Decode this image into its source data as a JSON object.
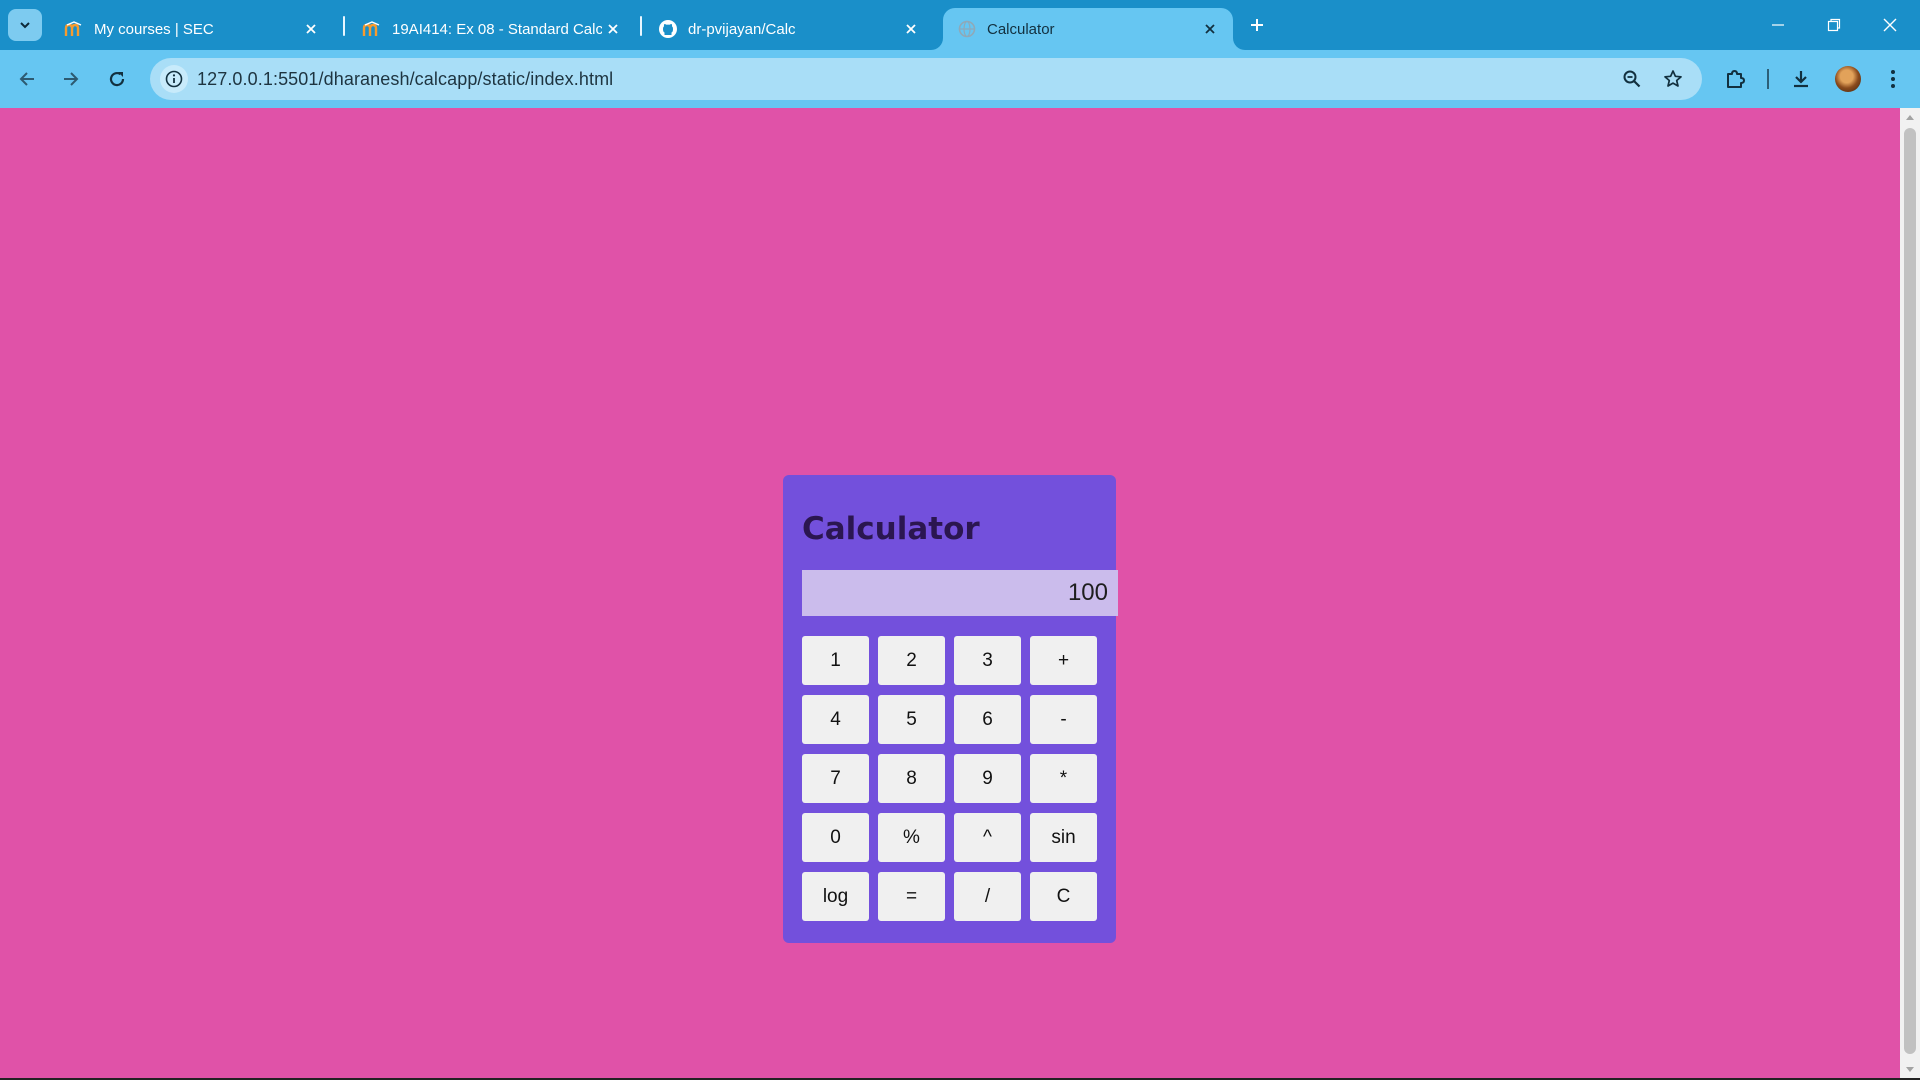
{
  "browser": {
    "tabs": [
      {
        "title": "My courses | SEC",
        "icon": "moodle-icon",
        "active": false
      },
      {
        "title": "19AI414: Ex 08 - Standard Calcu",
        "icon": "moodle-icon",
        "active": false
      },
      {
        "title": "dr-pvijayan/Calc",
        "icon": "github-icon",
        "active": false
      },
      {
        "title": "Calculator",
        "icon": "globe-icon",
        "active": true
      }
    ],
    "address": "127.0.0.1:5501/dharanesh/calcapp/static/index.html"
  },
  "calculator": {
    "title": "Calculator",
    "display": "100",
    "keys": [
      "1",
      "2",
      "3",
      "+",
      "4",
      "5",
      "6",
      "-",
      "7",
      "8",
      "9",
      "*",
      "0",
      "%",
      "^",
      "sin",
      "log",
      "=",
      "/",
      "C"
    ]
  },
  "colors": {
    "browser_frame": "#1a8fc9",
    "toolbar": "#66c6f2",
    "page_background": "#e052a8",
    "calculator_panel": "#7350dc",
    "display_background": "#cbbcec",
    "key_background": "#f0f0f0"
  }
}
